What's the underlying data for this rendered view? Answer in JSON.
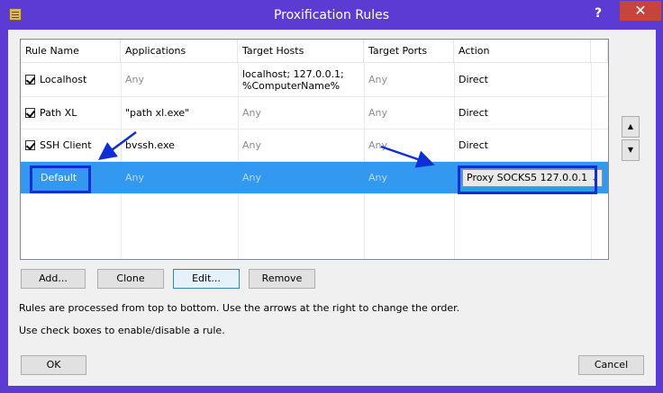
{
  "window": {
    "title": "Proxification Rules",
    "help_label": "?",
    "close_label": "✕"
  },
  "grid": {
    "columns": [
      "Rule Name",
      "Applications",
      "Target Hosts",
      "Target Ports",
      "Action"
    ],
    "rows": [
      {
        "name": "Localhost",
        "checked": true,
        "applications": "Any",
        "hosts_line1": "localhost; 127.0.0.1;",
        "hosts_line2": "%ComputerName%",
        "ports": "Any",
        "action": "Direct"
      },
      {
        "name": "Path XL",
        "checked": true,
        "applications": "\"path xl.exe\"",
        "hosts_line1": "Any",
        "ports": "Any",
        "action": "Direct"
      },
      {
        "name": "SSH Client",
        "checked": true,
        "applications": "bvssh.exe",
        "hosts_line1": "Any",
        "ports": "Any",
        "action": "Direct"
      },
      {
        "name": "Default",
        "applications": "Any",
        "hosts_line1": "Any",
        "ports": "Any",
        "action": "Proxy SOCKS5 127.0.0.1"
      }
    ]
  },
  "side_buttons": {
    "up": "▲",
    "down": "▼"
  },
  "buttons": {
    "add": "Add...",
    "clone": "Clone",
    "edit": "Edit...",
    "remove": "Remove",
    "ok": "OK",
    "cancel": "Cancel"
  },
  "notes": {
    "line1": "Rules are processed from top to bottom. Use the arrows at the right to change the order.",
    "line2": "Use check boxes to enable/disable a rule."
  },
  "colors": {
    "titlebar": "#5b3bd3",
    "selection": "#3398f0",
    "annotation": "#0f2fd6",
    "close": "#c7443c"
  },
  "icons": {
    "app": "rules-icon",
    "combo_arrow": "chevron-down-icon",
    "annotation": "arrow-icon"
  }
}
